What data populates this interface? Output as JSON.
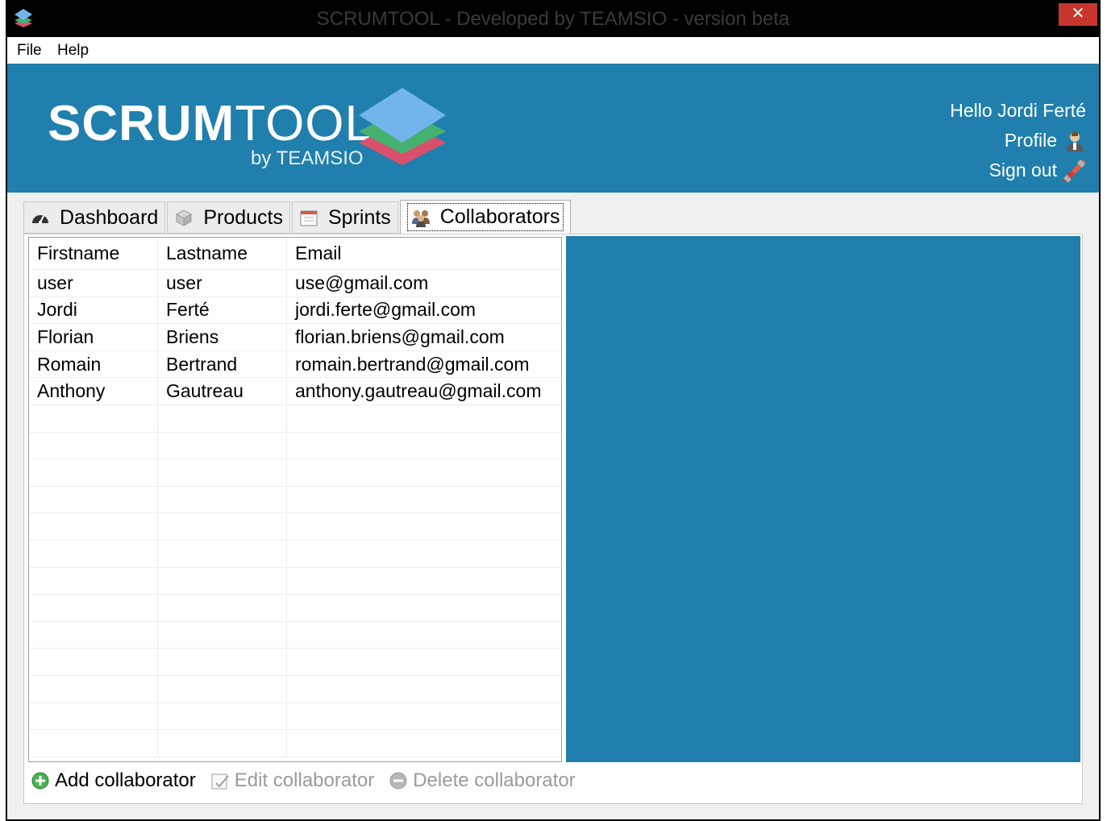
{
  "window": {
    "title": "SCRUMTOOL - Developed by TEAMSIO - version beta",
    "close_symbol": "✕"
  },
  "menu": {
    "items": [
      {
        "label": "File"
      },
      {
        "label": "Help"
      }
    ]
  },
  "header": {
    "logo_bold": "SCRUM",
    "logo_light": "TOOL",
    "logo_sub": "by TEAMSIO",
    "greeting": "Hello Jordi Ferté",
    "profile_label": "Profile",
    "signout_label": "Sign out",
    "colors": {
      "banner": "#207fac",
      "stack_top": "#72b4ec",
      "stack_mid": "#44b16f",
      "stack_bottom": "#d9506d"
    }
  },
  "tabs": [
    {
      "label": "Dashboard",
      "icon": "dashboard-icon",
      "active": false
    },
    {
      "label": "Products",
      "icon": "products-icon",
      "active": false
    },
    {
      "label": "Sprints",
      "icon": "sprints-icon",
      "active": false
    },
    {
      "label": "Collaborators",
      "icon": "collaborators-icon",
      "active": true
    }
  ],
  "table": {
    "columns": [
      "Firstname",
      "Lastname",
      "Email"
    ],
    "rows": [
      [
        "user",
        "user",
        "use@gmail.com"
      ],
      [
        "Jordi",
        "Ferté",
        "jordi.ferte@gmail.com"
      ],
      [
        "Florian",
        "Briens",
        "florian.briens@gmail.com"
      ],
      [
        "Romain",
        "Bertrand",
        "romain.bertrand@gmail.com"
      ],
      [
        "Anthony",
        "Gautreau",
        "anthony.gautreau@gmail.com"
      ]
    ]
  },
  "actions": {
    "add_label": "Add collaborator",
    "edit_label": "Edit collaborator",
    "delete_label": "Delete collaborator"
  }
}
